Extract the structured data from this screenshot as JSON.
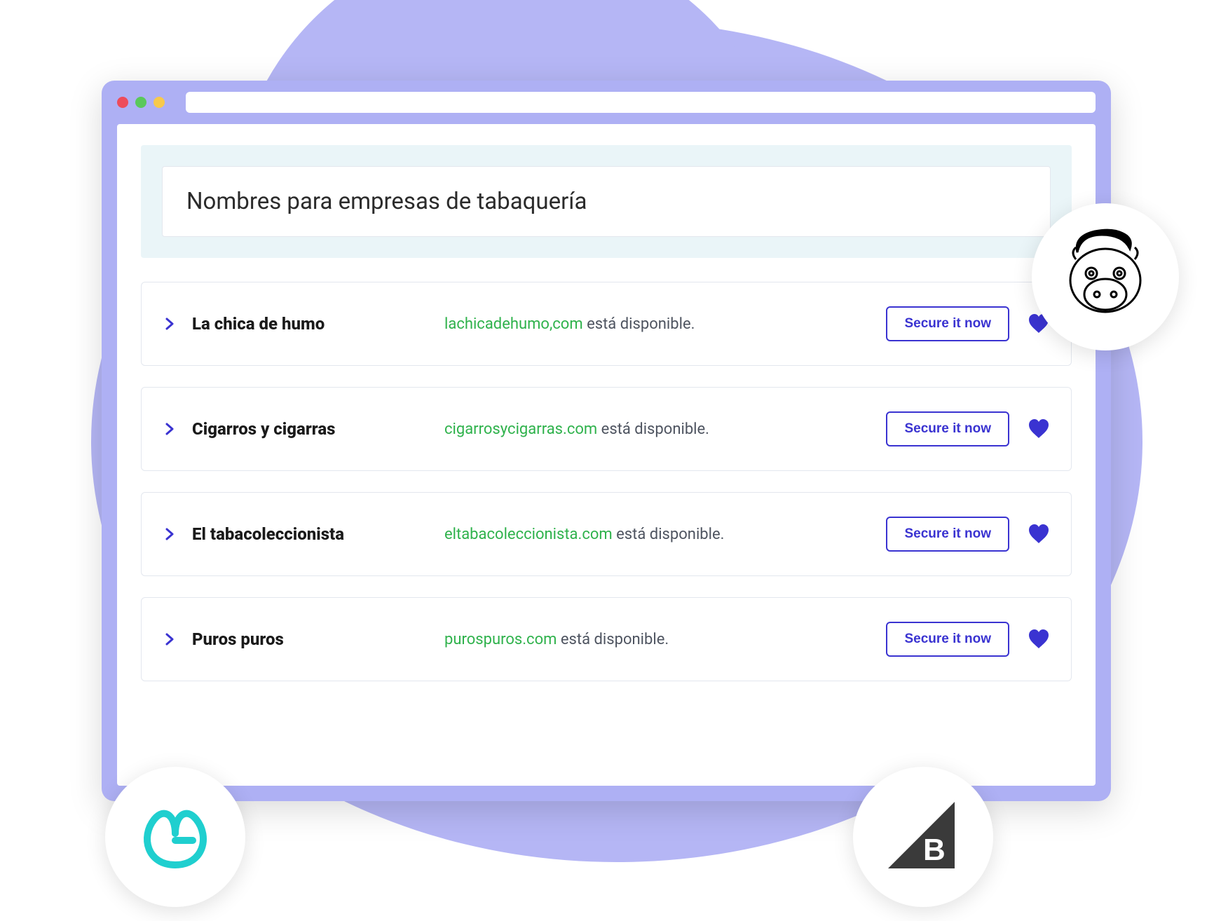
{
  "search": {
    "query": "Nombres para empresas de tabaquería"
  },
  "buttons": {
    "secure": "Secure it now"
  },
  "status_suffix": " está disponible.",
  "results": [
    {
      "name": "La chica de humo",
      "domain": "lachicadehumo,com"
    },
    {
      "name": "Cigarros y cigarras",
      "domain": "cigarrosycigarras.com"
    },
    {
      "name": "El tabacoleccionista",
      "domain": "eltabacoleccionista.com"
    },
    {
      "name": "Puros puros",
      "domain": "purospuros.com"
    }
  ],
  "colors": {
    "accent": "#3a33d1",
    "available": "#2fb24c",
    "blob": "#b5b6f5"
  }
}
